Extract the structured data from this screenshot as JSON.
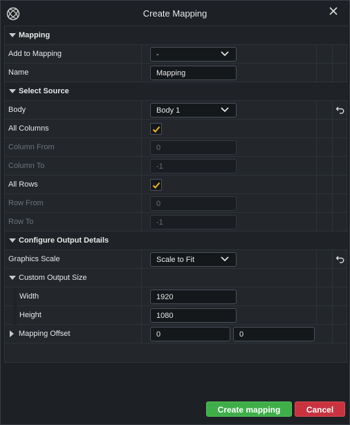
{
  "window": {
    "title": "Create Mapping",
    "logo_icon": "app-logo-icon",
    "close_icon": "close-icon"
  },
  "sections": {
    "mapping": {
      "label": "Mapping"
    },
    "select_source": {
      "label": "Select Source"
    },
    "configure_output": {
      "label": "Configure Output Details"
    }
  },
  "mapping": {
    "add_to_mapping": {
      "label": "Add to Mapping",
      "value": "-"
    },
    "name": {
      "label": "Name",
      "value": "Mapping"
    }
  },
  "source": {
    "body": {
      "label": "Body",
      "value": "Body 1"
    },
    "all_columns": {
      "label": "All Columns",
      "checked": true
    },
    "column_from": {
      "label": "Column From",
      "value": "0"
    },
    "column_to": {
      "label": "Column To",
      "value": "-1"
    },
    "all_rows": {
      "label": "All Rows",
      "checked": true
    },
    "row_from": {
      "label": "Row From",
      "value": "0"
    },
    "row_to": {
      "label": "Row To",
      "value": "-1"
    }
  },
  "output": {
    "graphics_scale": {
      "label": "Graphics Scale",
      "value": "Scale to Fit"
    },
    "custom_output_size": {
      "label": "Custom Output Size"
    },
    "width": {
      "label": "Width",
      "value": "1920"
    },
    "height": {
      "label": "Height",
      "value": "1080"
    },
    "mapping_offset": {
      "label": "Mapping Offset",
      "x": "0",
      "y": "0"
    }
  },
  "buttons": {
    "create": "Create mapping",
    "cancel": "Cancel"
  },
  "colors": {
    "accent_check": "#f0b429",
    "create_green": "#3fae49",
    "cancel_red": "#c9333f"
  }
}
